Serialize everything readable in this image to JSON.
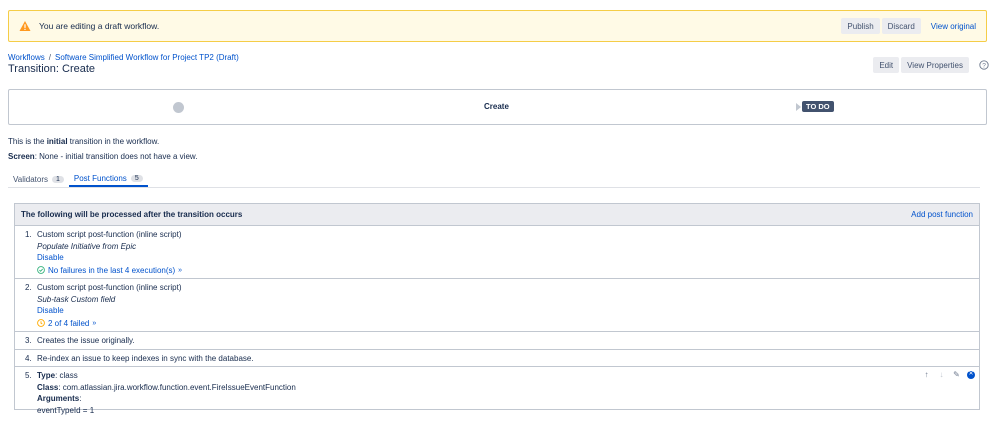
{
  "banner": {
    "message": "You are editing a draft workflow.",
    "publish": "Publish",
    "discard": "Discard",
    "view_original": "View original"
  },
  "breadcrumb": {
    "workflows": "Workflows",
    "separator": "/",
    "workflow_name": "Software Simplified Workflow for Project TP2 (Draft)"
  },
  "title": "Transition: Create",
  "header_actions": {
    "edit": "Edit",
    "view_properties": "View Properties"
  },
  "diagram": {
    "transition": "Create",
    "target_status": "TO DO"
  },
  "info": {
    "line1_pre": "This is the ",
    "line1_bold": "initial",
    "line1_post": " transition in the workflow.",
    "screen_label": "Screen",
    "screen_value": ": None - initial transition does not have a view."
  },
  "tabs": [
    {
      "label": "Validators",
      "count": "1"
    },
    {
      "label": "Post Functions",
      "count": "5"
    }
  ],
  "post_functions": {
    "header": "The following will be processed after the transition occurs",
    "add_link": "Add post function",
    "items": [
      {
        "num": "1.",
        "title": "Custom script post-function (inline script)",
        "subtitle": "Populate Initiative from Epic",
        "action": "Disable",
        "status": "No failures in the last 4 execution(s)",
        "status_color": "#36b37e"
      },
      {
        "num": "2.",
        "title": "Custom script post-function (inline script)",
        "subtitle": "Sub-task Custom field",
        "action": "Disable",
        "status": "2 of 4 failed",
        "status_color": "#ffab00"
      },
      {
        "num": "3.",
        "text": "Creates the issue originally."
      },
      {
        "num": "4.",
        "text": "Re-index an issue to keep indexes in sync with the database."
      },
      {
        "num": "5.",
        "type_label": "Type",
        "type_value": ": class",
        "class_label": "Class",
        "class_value": ": com.atlassian.jira.workflow.function.event.FireIssueEventFunction",
        "args_label": "Arguments",
        "args_colon": ":",
        "arg_value": "eventTypeId = 1"
      }
    ]
  },
  "icons": {
    "warning": "warning-icon",
    "help": "help-icon",
    "success": "check-circle-icon",
    "clock": "clock-icon",
    "move_up": "arrow-up-icon",
    "move_down": "arrow-down-icon",
    "edit": "pencil-icon",
    "delete": "delete-icon"
  }
}
